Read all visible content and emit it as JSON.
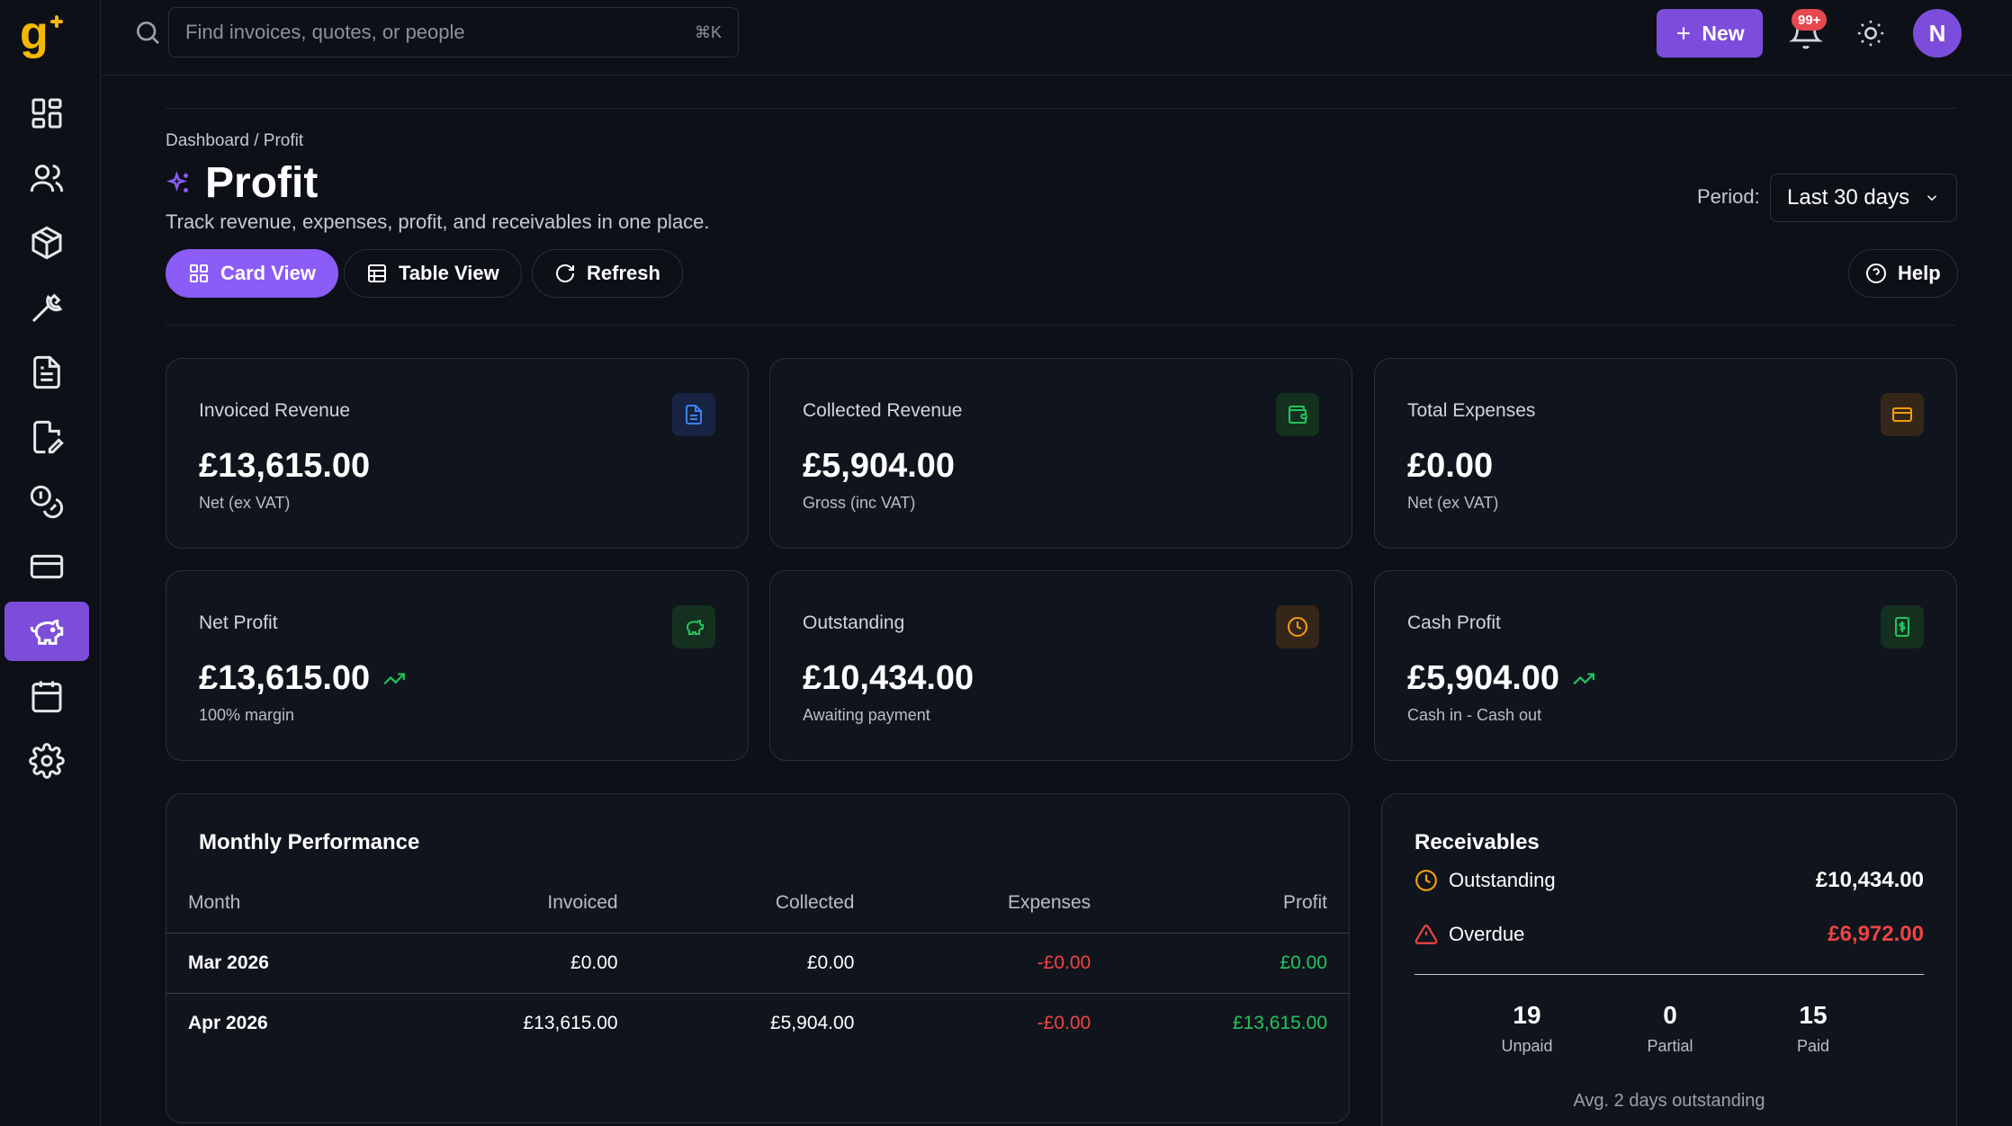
{
  "app": {
    "logo_letter": "g"
  },
  "sidebar": {
    "items": [
      {
        "name": "dashboard"
      },
      {
        "name": "people"
      },
      {
        "name": "products"
      },
      {
        "name": "tools"
      },
      {
        "name": "invoices"
      },
      {
        "name": "quotes"
      },
      {
        "name": "payments"
      },
      {
        "name": "cards"
      },
      {
        "name": "profit",
        "active": true
      },
      {
        "name": "calendar"
      },
      {
        "name": "settings"
      }
    ]
  },
  "topbar": {
    "search_placeholder": "Find invoices, quotes, or people",
    "search_shortcut": "⌘K",
    "new_label": "New",
    "notification_badge": "99+",
    "avatar_initial": "N"
  },
  "page": {
    "breadcrumb": "Dashboard / Profit",
    "title": "Profit",
    "subtitle": "Track revenue, expenses, profit, and receivables in one place.",
    "period_label": "Period:",
    "period_value": "Last 30 days",
    "views": {
      "card": "Card View",
      "table": "Table View",
      "refresh": "Refresh",
      "help": "Help"
    }
  },
  "cards": [
    {
      "label": "Invoiced Revenue",
      "value": "£13,615.00",
      "sub": "Net (ex VAT)",
      "icon": "document-icon",
      "color": "#3b82f6"
    },
    {
      "label": "Collected Revenue",
      "value": "£5,904.00",
      "sub": "Gross (inc VAT)",
      "icon": "wallet-icon",
      "color": "#22c55e"
    },
    {
      "label": "Total Expenses",
      "value": "£0.00",
      "sub": "Net (ex VAT)",
      "icon": "card-icon",
      "color": "#f59e0b"
    },
    {
      "label": "Net Profit",
      "value": "£13,615.00",
      "sub": "100% margin",
      "icon": "piggy-bank-icon",
      "color": "#22c55e",
      "trend": true
    },
    {
      "label": "Outstanding",
      "value": "£10,434.00",
      "sub": "Awaiting payment",
      "icon": "clock-icon",
      "color": "#f59e0b"
    },
    {
      "label": "Cash Profit",
      "value": "£5,904.00",
      "sub": "Cash in - Cash out",
      "icon": "cash-icon",
      "color": "#22c55e",
      "trend": true
    }
  ],
  "monthly": {
    "title": "Monthly Performance",
    "columns": [
      "Month",
      "Invoiced",
      "Collected",
      "Expenses",
      "Profit"
    ],
    "rows": [
      [
        "Mar 2026",
        "£0.00",
        "£0.00",
        "-£0.00",
        "£0.00"
      ],
      [
        "Apr 2026",
        "£13,615.00",
        "£5,904.00",
        "-£0.00",
        "£13,615.00"
      ]
    ]
  },
  "receivables": {
    "title": "Receivables",
    "outstanding_label": "Outstanding",
    "outstanding_value": "£10,434.00",
    "overdue_label": "Overdue",
    "overdue_value": "£6,972.00",
    "stats": [
      {
        "n": "19",
        "l": "Unpaid"
      },
      {
        "n": "0",
        "l": "Partial"
      },
      {
        "n": "15",
        "l": "Paid"
      }
    ],
    "avg": "Avg. 2 days outstanding"
  },
  "colors": {
    "accent": "#7c4ddb",
    "accent_light": "#8b5cf6",
    "negative": "#ef4444",
    "positive": "#22c55e",
    "warning": "#f59e0b"
  }
}
